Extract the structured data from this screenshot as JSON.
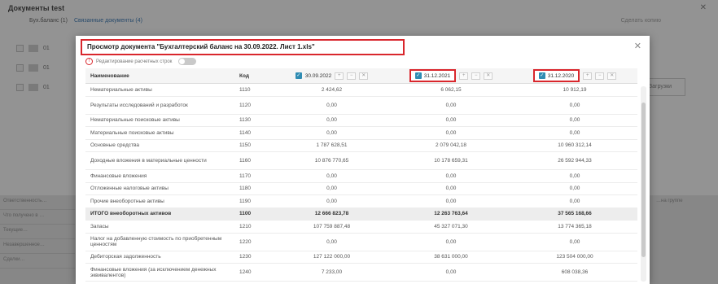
{
  "background": {
    "title": "Документы test",
    "tab1": "Бух.баланс (1)",
    "tab2": "Связанные документы (4)",
    "right_label": "Сделать копию",
    "side_button": "Загрузки",
    "rows": [
      "01",
      "01",
      "01"
    ],
    "bottom_left": [
      "Ответственность…",
      "Что получено в …",
      "Текущие…",
      "Незавершенное…",
      "Сделки…"
    ],
    "bottom_right": [
      "…на группе",
      "",
      "",
      ""
    ]
  },
  "modal": {
    "title": "Просмотр документа \"Бухгалтерский баланс на 30.09.2022. Лист 1.xls\"",
    "toggle_label": "Редактирование расчетных строк",
    "columns": {
      "name": "Наименование",
      "code": "Код",
      "dates": [
        "30.09.2022",
        "31.12.2021",
        "31.12.2020"
      ]
    },
    "rows": [
      {
        "name": "Нематериальные активы",
        "code": "1110",
        "v": [
          "2 424,62",
          "6 062,15",
          "10 912,19"
        ],
        "bold": false
      },
      {
        "name": "Результаты исследований и разработок",
        "code": "1120",
        "v": [
          "0,00",
          "0,00",
          "0,00"
        ],
        "bold": false
      },
      {
        "name": "Нематериальные поисковые активы",
        "code": "1130",
        "v": [
          "0,00",
          "0,00",
          "0,00"
        ],
        "bold": false
      },
      {
        "name": "Материальные поисковые активы",
        "code": "1140",
        "v": [
          "0,00",
          "0,00",
          "0,00"
        ],
        "bold": false
      },
      {
        "name": "Основные средства",
        "code": "1150",
        "v": [
          "1 787 628,51",
          "2 079 042,18",
          "10 960 312,14"
        ],
        "bold": false
      },
      {
        "name": "Доходные вложения в материальные ценности",
        "code": "1160",
        "v": [
          "10 876 770,65",
          "10 178 659,31",
          "26 592 944,33"
        ],
        "bold": false
      },
      {
        "name": "Финансовые вложения",
        "code": "1170",
        "v": [
          "0,00",
          "0,00",
          "0,00"
        ],
        "bold": false
      },
      {
        "name": "Отложенные налоговые активы",
        "code": "1180",
        "v": [
          "0,00",
          "0,00",
          "0,00"
        ],
        "bold": false
      },
      {
        "name": "Прочие внеоборотные активы",
        "code": "1190",
        "v": [
          "0,00",
          "0,00",
          "0,00"
        ],
        "bold": false
      },
      {
        "name": "ИТОГО внеоборотных активов",
        "code": "1100",
        "v": [
          "12 666 823,78",
          "12 263 763,64",
          "37 565 168,66"
        ],
        "bold": true
      },
      {
        "name": "Запасы",
        "code": "1210",
        "v": [
          "107 759 887,48",
          "45 327 071,30",
          "13 774 365,18"
        ],
        "bold": false
      },
      {
        "name": "Налог на добавленную стоимость по приобретенным ценностям",
        "code": "1220",
        "v": [
          "0,00",
          "0,00",
          "0,00"
        ],
        "bold": false
      },
      {
        "name": "Дебиторская задолженность",
        "code": "1230",
        "v": [
          "127 122 000,00",
          "38 631 000,00",
          "123 504 000,00"
        ],
        "bold": false
      },
      {
        "name": "Финансовые вложения (за исключением денежных эквивалентов)",
        "code": "1240",
        "v": [
          "7 233,00",
          "0,00",
          "608 038,36"
        ],
        "bold": false
      }
    ]
  }
}
